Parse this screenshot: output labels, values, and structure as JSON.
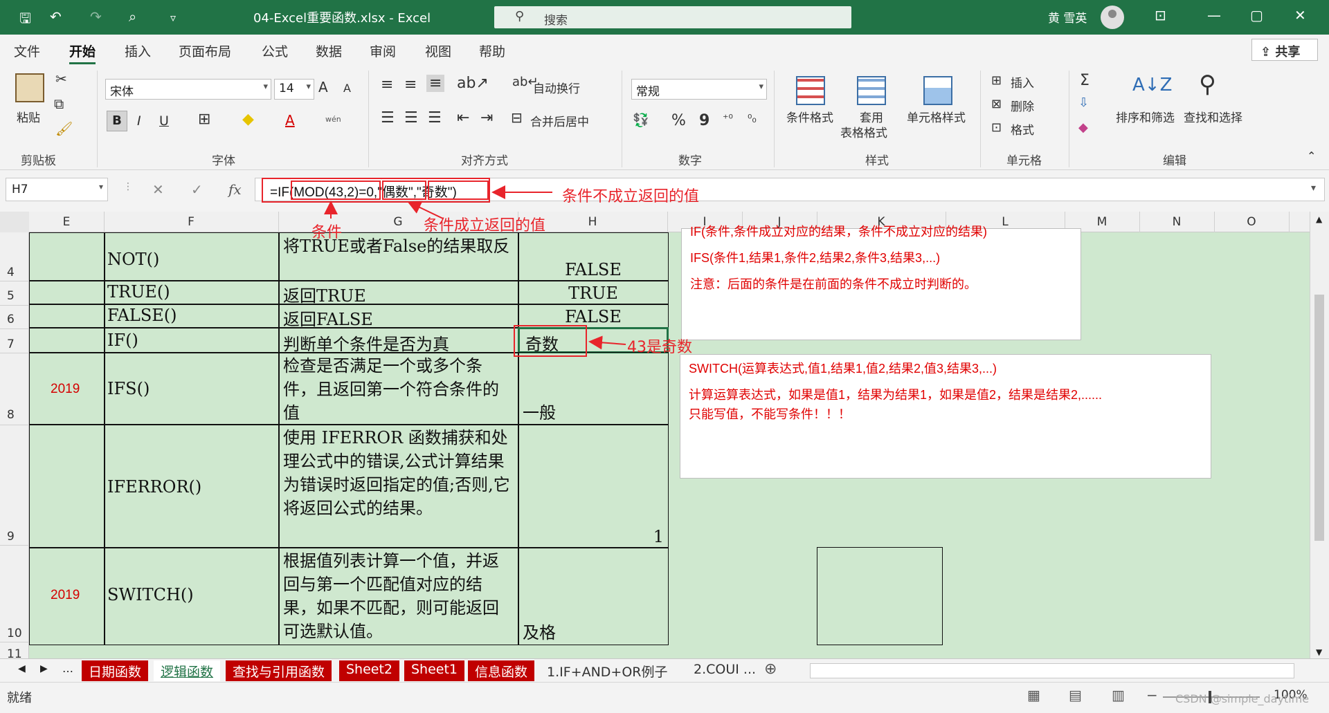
{
  "titlebar": {
    "filename": "04-Excel重要函数.xlsx  -  Excel",
    "search_placeholder": "搜索",
    "user": "黄 雪英",
    "qa_save": "🖫",
    "qa_undo": "↶",
    "qa_redo": "↷",
    "qa_touch": "⌕",
    "qa_more": "▿",
    "win_ribbon": "⊡",
    "win_min": "—",
    "win_max": "▢",
    "win_close": "✕"
  },
  "ribbon_tabs": [
    "文件",
    "开始",
    "插入",
    "页面布局",
    "公式",
    "数据",
    "审阅",
    "视图",
    "帮助"
  ],
  "share_label": "共享",
  "ribbon": {
    "clipboard": {
      "paste": "粘贴",
      "label": "剪贴板"
    },
    "font": {
      "name": "宋体",
      "size": "14",
      "label": "字体",
      "bold": "B",
      "italic": "I",
      "underline": "U",
      "grow": "A",
      "shrink": "A",
      "font_color": "A",
      "wen": "wén"
    },
    "align": {
      "wrap": "自动换行",
      "merge": "合并后居中",
      "label": "对齐方式"
    },
    "number": {
      "format": "常规",
      "percent": "%",
      "comma": "9",
      "label": "数字"
    },
    "styles": {
      "cond": "条件格式",
      "table1": "套用",
      "table2": "表格格式",
      "cell": "单元格样式",
      "label": "样式"
    },
    "cells": {
      "insert": "插入",
      "delete": "删除",
      "format": "格式",
      "label": "单元格"
    },
    "edit": {
      "sum": "Σ",
      "sort": "排序和筛选",
      "find": "查找和选择",
      "label": "编辑"
    }
  },
  "formula_bar": {
    "name_box": "H7",
    "fx": "fx",
    "cancel": "✕",
    "enter": "✓",
    "formula": "=IF(MOD(43,2)=0,\"偶数\",\"奇数\")"
  },
  "columns": [
    "E",
    "F",
    "G",
    "H",
    "I",
    "J",
    "K",
    "L",
    "M",
    "N",
    "O"
  ],
  "rows": [
    "4",
    "5",
    "6",
    "7",
    "8",
    "9",
    "10",
    "11"
  ],
  "table": [
    {
      "year": "",
      "func": "NOT()",
      "desc": "将TRUE或者False的结果取反",
      "result": "FALSE"
    },
    {
      "year": "",
      "func": "TRUE()",
      "desc": "返回TRUE",
      "result": "TRUE"
    },
    {
      "year": "",
      "func": "FALSE()",
      "desc": "返回FALSE",
      "result": "FALSE"
    },
    {
      "year": "",
      "func": "IF()",
      "desc": "判断单个条件是否为真",
      "result": "奇数"
    },
    {
      "year": "2019",
      "func": "IFS()",
      "desc": "检查是否满足一个或多个条件，且返回第一个符合条件的值",
      "result": "一般"
    },
    {
      "year": "",
      "func": "IFERROR()",
      "desc": "使用 IFERROR 函数捕获和处理公式中的错误,公式计算结果为错误时返回指定的值;否则,它将返回公式的结果。",
      "result": "1"
    },
    {
      "year": "2019",
      "func": "SWITCH()",
      "desc": "根据值列表计算一个值，并返回与第一个匹配值对应的结果，如果不匹配，则可能返回可选默认值。",
      "result": "及格"
    }
  ],
  "notes": {
    "box1": [
      "IF(条件,条件成立对应的结果，条件不成立对应的结果)",
      "IFS(条件1,结果1,条件2,结果2,条件3,结果3,...)",
      "注意：后面的条件是在前面的条件不成立时判断的。"
    ],
    "box2": [
      "SWITCH(运算表达式,值1,结果1,值2,结果2,值3,结果3,...)",
      "计算运算表达式，如果是值1，结果为结果1，如果是值2，结果是结果2,......",
      "只能写值，不能写条件！！！"
    ]
  },
  "annotations": {
    "false_value": "条件不成立返回的值",
    "condition": "条件",
    "true_value": "条件成立返回的值",
    "odd": "43是奇数"
  },
  "sheet_tabs": [
    {
      "label": "日期函数",
      "style": "red"
    },
    {
      "label": "逻辑函数",
      "style": "active"
    },
    {
      "label": "查找与引用函数",
      "style": "red"
    },
    {
      "label": "Sheet2",
      "style": "red"
    },
    {
      "label": "Sheet1",
      "style": "red"
    },
    {
      "label": "信息函数",
      "style": "red"
    },
    {
      "label": "1.IF+AND+OR例子",
      "style": "plain"
    },
    {
      "label": "2.COUI ...",
      "style": "plain"
    }
  ],
  "status": {
    "ready": "就绪",
    "zoom": "100%",
    "watermark": "CSDN @simple_daytime"
  },
  "colors": {
    "excel_green": "#217346",
    "annotation_red": "#e8242b",
    "cell_fill": "#cfe8cf",
    "tab_red": "#c00000"
  }
}
